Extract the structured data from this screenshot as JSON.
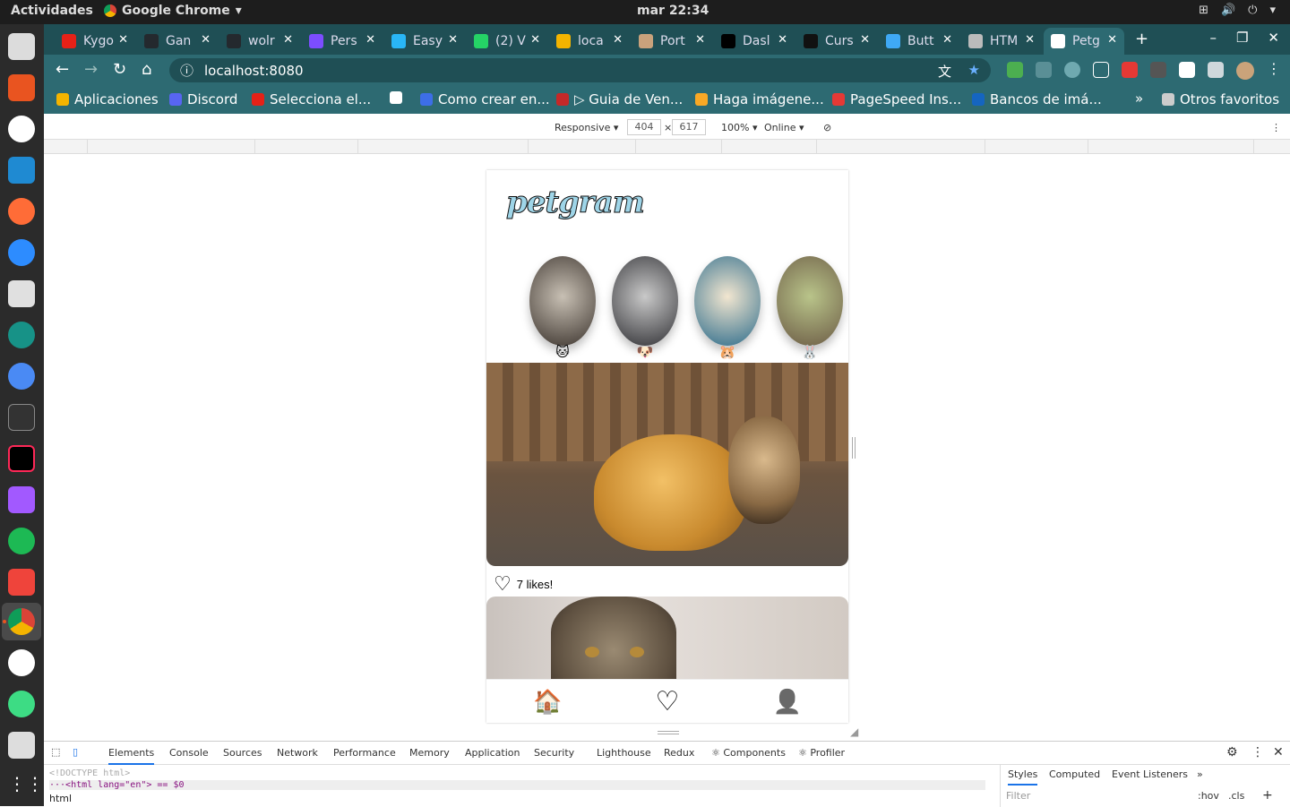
{
  "system": {
    "activities": "Actividades",
    "app_name": "Google Chrome",
    "clock": "mar 22:34"
  },
  "browser": {
    "tabs": [
      {
        "label": "Kygo",
        "color": "#e62117"
      },
      {
        "label": "Gan",
        "color": "#24292e"
      },
      {
        "label": "wolr",
        "color": "#24292e"
      },
      {
        "label": "Pers",
        "color": "#7c4dff"
      },
      {
        "label": "Easy",
        "color": "#29b6f6"
      },
      {
        "label": "(2) V",
        "color": "#25d366"
      },
      {
        "label": "loca",
        "color": "#f4b400"
      },
      {
        "label": "Port",
        "color": "#c9a27c"
      },
      {
        "label": "Dasl",
        "color": "#000000"
      },
      {
        "label": "Curs",
        "color": "#111111"
      },
      {
        "label": "Butt",
        "color": "#3fa9f5"
      },
      {
        "label": "HTM",
        "color": "#bbbbbb"
      },
      {
        "label": "Petg",
        "color": "#ffffff",
        "active": true
      }
    ],
    "url": "localhost:8080",
    "bookmarks": [
      {
        "label": "Aplicaciones",
        "color": "#f4b400"
      },
      {
        "label": "Discord",
        "color": "#5865f2"
      },
      {
        "label": "Selecciona el...",
        "color": "#e62117"
      },
      {
        "label": "",
        "color": "#ffffff"
      },
      {
        "label": "Como crear en...",
        "color": "#3d6ee8"
      },
      {
        "label": "▷ Guia de Ven...",
        "color": "#c62828"
      },
      {
        "label": "Haga imágene...",
        "color": "#f9a825"
      },
      {
        "label": "PageSpeed Ins...",
        "color": "#e53935"
      },
      {
        "label": "Bancos de imá...",
        "color": "#1565c0"
      },
      {
        "label": "Otros favoritos",
        "color": "#cccccc"
      }
    ],
    "bookmarks_more": "»"
  },
  "device_toolbar": {
    "mode": "Responsive ▾",
    "width": "404",
    "times": "×",
    "height": "617",
    "zoom": "100% ▾",
    "network": "Online ▾"
  },
  "app": {
    "logo": "petgram",
    "categories": [
      {
        "emoji": "🐱",
        "color_a": "#c8c0b4",
        "color_b": "#3a322c"
      },
      {
        "emoji": "🐶",
        "color_a": "#c9c9c9",
        "color_b": "#2f2f33"
      },
      {
        "emoji": "🐹",
        "color_a": "#f2e6d0",
        "color_b": "#2a6a8a"
      },
      {
        "emoji": "🐰",
        "color_a": "#b9c48a",
        "color_b": "#6b5a44"
      }
    ],
    "post_likes": "7 likes!",
    "nav": {
      "home_icon": "🏠",
      "favs_icon": "♡",
      "user_icon": "👤"
    }
  },
  "devtools": {
    "tabs": [
      "Elements",
      "Console",
      "Sources",
      "Network",
      "Performance",
      "Memory",
      "Application",
      "Security",
      "Lighthouse",
      "Redux",
      "⚛ Components",
      "⚛ Profiler"
    ],
    "active_tab": "Elements",
    "code_line1": "<!DOCTYPE html>",
    "code_line2": "···<html lang=\"en\"> == $0",
    "breadcrumb": "html",
    "side_tabs": [
      "Styles",
      "Computed",
      "Event Listeners",
      "»"
    ],
    "filter_placeholder": "Filter",
    "hov": ":hov",
    "cls": ".cls"
  }
}
